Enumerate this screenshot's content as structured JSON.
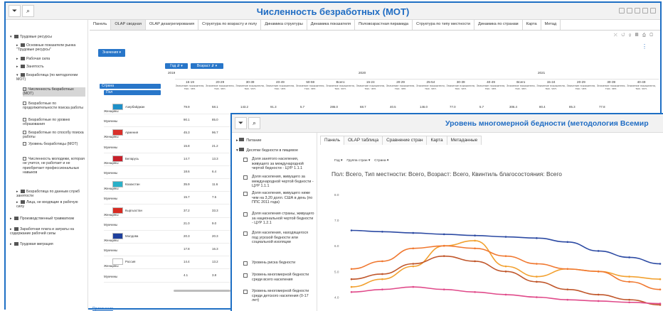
{
  "back_window": {
    "title": "Численность безработных (МОТ)",
    "tabs": [
      "Панель",
      "OLAP сводная",
      "OLAP дезагрегирования",
      "Структура по возрасту и полу",
      "Динамика структуры",
      "Динамика показателя",
      "Половозрастная пирамида",
      "Структура по типу местности",
      "Динамика по странам",
      "Карта",
      "Метад"
    ],
    "active_tab": 1,
    "sidebar": [
      {
        "label": "Трудовые ресурсы",
        "level": 0,
        "type": "folder",
        "arrow": "▾"
      },
      {
        "label": "Основные показатели рынка \"Трудовые ресурсы\"",
        "level": 1,
        "type": "folder",
        "arrow": "▸"
      },
      {
        "label": "Рабочая сила",
        "level": 1,
        "type": "folder",
        "arrow": "▸"
      },
      {
        "label": "Занятость",
        "level": 1,
        "type": "folder",
        "arrow": "▸"
      },
      {
        "label": "Безработица (по методологии МОТ)",
        "level": 1,
        "type": "folder",
        "arrow": "▾"
      },
      {
        "label": "Численность безработных (МОТ)",
        "level": 2,
        "type": "doc",
        "selected": true
      },
      {
        "label": "Безработные по продолжительности поиска работы",
        "level": 2,
        "type": "doc"
      },
      {
        "label": "Безработные по уровню образования",
        "level": 2,
        "type": "doc"
      },
      {
        "label": "Безработные по способу поиска работы",
        "level": 2,
        "type": "doc"
      },
      {
        "label": "Уровень безработицы (МОТ)",
        "level": 2,
        "type": "doc"
      },
      {
        "label": "Численность молодежи, которая не учится, не работает и не приобретает профессиональных навыков",
        "level": 2,
        "type": "doc"
      },
      {
        "label": "Безработица по данным служб занятости",
        "level": 1,
        "type": "folder",
        "arrow": "▸"
      },
      {
        "label": "Лица, не входящие в рабочую силу",
        "level": 1,
        "type": "folder",
        "arrow": "▸"
      },
      {
        "label": "Производственный травматизм",
        "level": 0,
        "type": "folder",
        "arrow": "▸"
      },
      {
        "label": "Заработная плата и затраты на содержание рабочей силы",
        "level": 0,
        "type": "folder",
        "arrow": "▸"
      },
      {
        "label": "Трудовая миграция",
        "level": 0,
        "type": "folder",
        "arrow": "▸"
      }
    ],
    "button_indicator": "Значения ▾",
    "pivot_filters": [
      "Год ⇵ ▾",
      "Возраст ⇵ ▾"
    ],
    "row_headers": [
      "Страна",
      "Пол"
    ],
    "years": [
      "2019",
      "2020",
      "2021"
    ],
    "column_groups": [
      "15-19",
      "20-29",
      "30-39",
      "40-49",
      "50-59",
      "Всего",
      "15-24",
      "20-29",
      "25-54",
      "30-39",
      "40-49",
      "Всего",
      "15-24",
      "20-29",
      "30-39",
      "40-49"
    ],
    "column_unit": "Значение показателя, тыс. чел.",
    "rows": [
      {
        "country": "Азербайджан",
        "sex": "Женщины",
        "vals": [
          "79.9",
          "58.1",
          "143.2",
          "91.3",
          "5.7",
          "286.0",
          "68.7",
          "40.5",
          "146.0",
          "77.0",
          "5.7",
          "306.4",
          "80.4",
          "85.3",
          "77.8"
        ]
      },
      {
        "country": "",
        "sex": "Мужчины",
        "vals": [
          "90.1",
          "85.0"
        ]
      },
      {
        "country": "Армения",
        "sex": "Женщины",
        "vals": [
          "45.3",
          "96.7"
        ]
      },
      {
        "country": "",
        "sex": "Мужчины",
        "vals": [
          "15.8",
          "21.2"
        ]
      },
      {
        "country": "Беларусь",
        "sex": "Женщины",
        "vals": [
          "14.7",
          "13.3"
        ]
      },
      {
        "country": "",
        "sex": "Мужчины",
        "vals": [
          "18.6",
          "6.4"
        ]
      },
      {
        "country": "Казахстан",
        "sex": "Женщины",
        "vals": [
          "35.9",
          "11.6"
        ]
      },
      {
        "country": "",
        "sex": "Мужчины",
        "vals": [
          "15.7",
          "7.5"
        ]
      },
      {
        "country": "Кыргызстан",
        "sex": "Женщины",
        "vals": [
          "37.2",
          "33.3"
        ]
      },
      {
        "country": "",
        "sex": "Мужчины",
        "vals": [
          "21.0",
          "9.0"
        ]
      },
      {
        "country": "Молдова",
        "sex": "Женщины",
        "vals": [
          "20.3",
          "20.3"
        ]
      },
      {
        "country": "",
        "sex": "Мужчины",
        "vals": [
          "17.8",
          "16.3"
        ]
      },
      {
        "country": "Россия",
        "sex": "Женщины",
        "vals": [
          "14.4",
          "13.2"
        ]
      },
      {
        "country": "",
        "sex": "Мужчины",
        "vals": [
          "4.1",
          "3.8"
        ]
      }
    ],
    "footer_link": "Примечания"
  },
  "front_window": {
    "title": "Уровень многомерной бедности (методология Всемир",
    "tabs": [
      "Панель",
      "OLAP таблица",
      "Сравнение стран",
      "Карта",
      "Метаданные"
    ],
    "active_tab": 0,
    "sidebar": [
      {
        "label": "Питание",
        "type": "folder",
        "arrow": "▸"
      },
      {
        "label": "Десятки бедности в пищевое",
        "type": "folder",
        "arrow": "▾"
      },
      {
        "label": "Доля занятого населения, живущего за международной чертой бедности - ЦУР 1.1.1",
        "type": "doc"
      },
      {
        "label": "Доля населения, живущего за международной чертой бедности - ЦУР 1.1.1",
        "type": "doc"
      },
      {
        "label": "Доля населения, живущего ниже чем на 3,20 долл. США в день (по ППС 2011 года)",
        "type": "doc"
      },
      {
        "label": "Доля населения страны, живущего за национальной чертой бедности - ЦУР 1.2.1",
        "type": "doc"
      },
      {
        "label": "Доля населения, находящегося под угрозой бедности или социальной изоляции",
        "type": "doc"
      },
      {
        "label": "Уровень риска бедности",
        "type": "doc"
      },
      {
        "label": "Уровень многомерной бедности среди всего населения",
        "type": "doc"
      },
      {
        "label": "Уровень многомерной бедности среди детского населения (0-17 лет)",
        "type": "doc"
      }
    ],
    "filters": [
      "Год ▾",
      "Группа стран ▾",
      "Страна ▾"
    ],
    "chart_subtitle": "Пол: Всего, Тип местности: Всего, Возраст: Всего, Квинтиль благосостояния: Всего"
  },
  "chart_data": {
    "type": "line",
    "title": "",
    "subtitle": "Пол: Всего, Тип местности: Всего, Возраст: Всего, Квинтиль благосостояния: Всего",
    "xlabel": "",
    "ylabel": "",
    "y_ticks": [
      "8.0",
      "7.0",
      "6.0",
      "5.0",
      "4.0"
    ],
    "ylim": [
      3.6,
      8.3
    ],
    "x": [
      0,
      1,
      2,
      3,
      4,
      5,
      6,
      7,
      8,
      9,
      10
    ],
    "series": [
      {
        "color": "#2c4aa3",
        "values": [
          6.6,
          6.55,
          6.5,
          6.45,
          6.4,
          6.35,
          6.3,
          6.15,
          5.8,
          5.55,
          5.3
        ]
      },
      {
        "color": "#f2a130",
        "values": [
          4.4,
          4.7,
          5.2,
          6.0,
          6.2,
          5.2,
          4.8,
          5.1,
          5.0,
          4.8,
          4.7
        ]
      },
      {
        "color": "#f07830",
        "values": [
          5.1,
          5.4,
          5.9,
          6.0,
          5.9,
          5.6,
          5.3,
          5.1,
          5.0,
          4.6,
          4.3
        ]
      },
      {
        "color": "#c0562a",
        "values": [
          4.7,
          4.9,
          5.3,
          5.6,
          5.4,
          5.0,
          4.6,
          4.3,
          4.1,
          3.9,
          3.7
        ]
      },
      {
        "color": "#e04a8a",
        "values": [
          4.2,
          4.3,
          4.4,
          4.3,
          4.2,
          4.1,
          4.0,
          3.9,
          3.85,
          3.8,
          3.75
        ]
      }
    ],
    "grid": false,
    "legend": "none"
  },
  "colors": {
    "accent": "#1f6cc3",
    "button": "#2876c9",
    "border": "#1e6fc4"
  },
  "icons": [
    "filter-icon",
    "search-icon",
    "folder-icon",
    "document-icon",
    "chevron-down-icon",
    "print-icon",
    "menu-dots-icon"
  ]
}
